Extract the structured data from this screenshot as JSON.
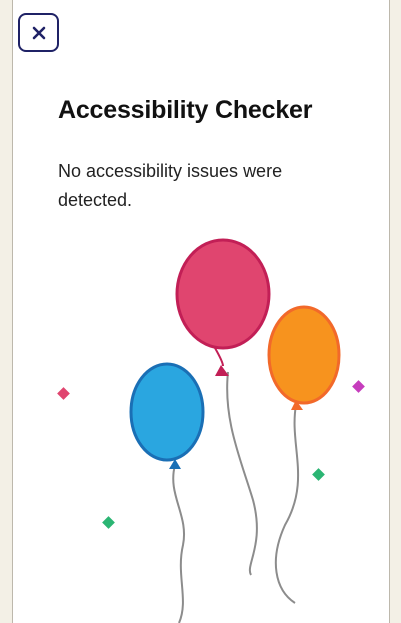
{
  "dialog": {
    "title": "Accessibility Checker",
    "message": "No accessibility issues were detected."
  },
  "icons": {
    "close": "close-icon",
    "illustration": "celebration-balloons-icon"
  },
  "colors": {
    "close_border": "#1f2266",
    "balloon_pink": "#e0456f",
    "balloon_orange": "#f7931e",
    "balloon_blue": "#2aa6e0",
    "confetti_green": "#2bb573",
    "confetti_pink": "#e0456f",
    "confetti_purple": "#c63dbd"
  }
}
